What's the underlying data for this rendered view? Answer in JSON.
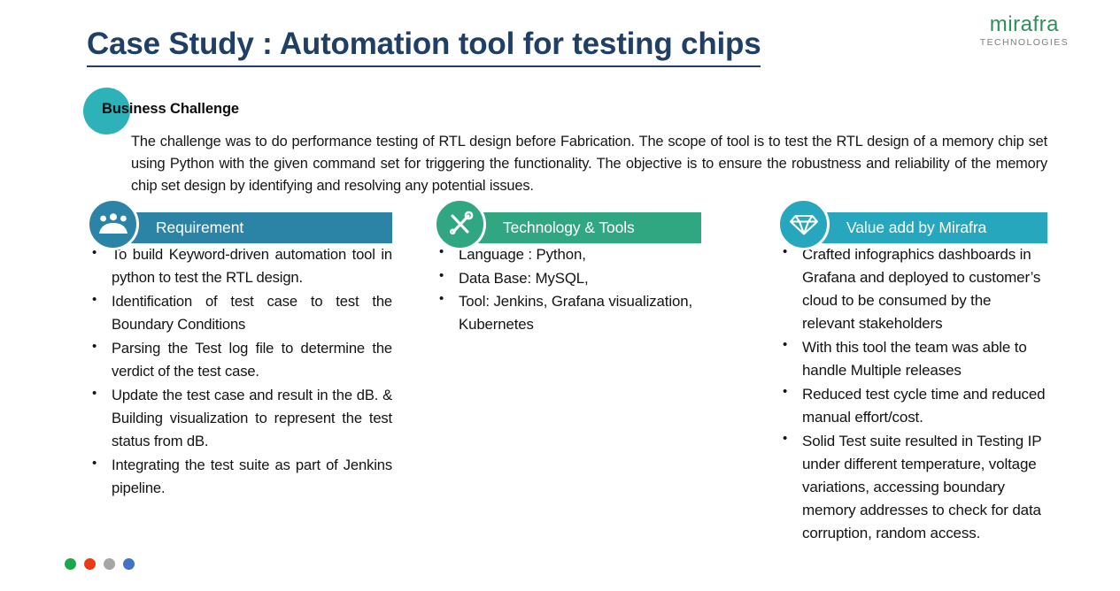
{
  "logo": {
    "name": "mirafra",
    "tagline": "TECHNOLOGIES",
    "name_color": "#2f8f5b",
    "tagline_color": "#7d7d7d"
  },
  "title": "Case Study : Automation tool for testing chips",
  "title_color": "#1f3f66",
  "business_challenge": {
    "label": "Business Challenge",
    "circle_color": "#2cb2b8",
    "body": "The challenge was to do performance testing of RTL design before Fabrication. The scope of tool is to test the RTL design of a memory chip set using Python with the given command set for triggering the functionality. The objective is to ensure the robustness and reliability of the memory chip set design by identifying and resolving any potential issues."
  },
  "columns": [
    {
      "id": "requirement",
      "heading": "Requirement",
      "icon": "people-group-icon",
      "color": "#2b84a6",
      "bullets": [
        "To build Keyword-driven automation tool in python to test the RTL design.",
        "Identification of test case to test the Boundary Conditions",
        "Parsing the Test log file to determine the verdict of the test case.",
        "Update the test case and result in the  dB. & Building visualization to represent the test status from dB.",
        "Integrating the test suite as part of Jenkins pipeline."
      ]
    },
    {
      "id": "technology-tools",
      "heading": "Technology & Tools",
      "icon": "wrench-screwdriver-icon",
      "color": "#30a681",
      "bullets": [
        "Language : Python,",
        "Data Base: MySQL,",
        "Tool: Jenkins, Grafana visualization, Kubernetes"
      ]
    },
    {
      "id": "value-add",
      "heading": "Value add by Mirafra",
      "icon": "diamond-icon",
      "color": "#27a7bd",
      "bullets": [
        "Crafted infographics dashboards in Grafana and deployed to customer’s cloud to be consumed by the relevant stakeholders",
        "With this tool the team was able to handle Multiple releases",
        "Reduced test cycle time and reduced manual effort/cost.",
        "Solid Test suite resulted in Testing IP under different temperature, voltage variations, accessing boundary memory addresses to check for data corruption, random access."
      ]
    }
  ],
  "footer_dots": [
    {
      "name": "dot-green",
      "color": "#18a94b"
    },
    {
      "name": "dot-red",
      "color": "#ec3a17"
    },
    {
      "name": "dot-gray",
      "color": "#a6a6a6"
    },
    {
      "name": "dot-blue",
      "color": "#4472c4"
    }
  ]
}
